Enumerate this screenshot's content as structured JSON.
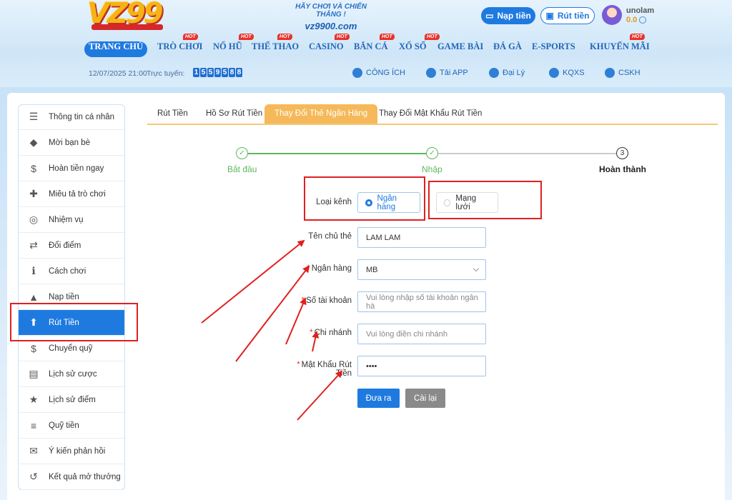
{
  "header": {
    "slogan_line1": "HÃY CHƠI VÀ CHIẾN THẮNG !",
    "slogan_line2": "vz9900.com",
    "deposit_label": "Nạp tiền",
    "withdraw_label": "Rút tiền",
    "username": "unolam",
    "balance": "0.0",
    "hot_badge": "HOT",
    "nav": [
      {
        "label": "TRANG CHỦ",
        "hot": false
      },
      {
        "label": "TRÒ CHƠI",
        "hot": true
      },
      {
        "label": "NỔ HŨ",
        "hot": true
      },
      {
        "label": "THỂ THAO",
        "hot": true
      },
      {
        "label": "CASINO",
        "hot": true
      },
      {
        "label": "BẮN CÁ",
        "hot": true
      },
      {
        "label": "XỔ SỐ",
        "hot": true
      },
      {
        "label": "GAME BÀI",
        "hot": false
      },
      {
        "label": "ĐÁ GÀ",
        "hot": false
      },
      {
        "label": "E-SPORTS",
        "hot": false
      },
      {
        "label": "KHUYẾN MÃI",
        "hot": true
      }
    ],
    "datetime": "12/07/2025 21:00",
    "online_label": "Trực tuyến:",
    "online_digits": [
      "1",
      "5",
      "5",
      "9",
      "5",
      "8",
      "8"
    ],
    "utilities": [
      "CÔNG ÍCH",
      "Tải APP",
      "Đại Lý",
      "KQXS",
      "CSKH"
    ]
  },
  "sidebar": {
    "items": [
      {
        "label": "Thông tin cá nhân",
        "icon": "user-card-icon"
      },
      {
        "label": "Mời bạn bè",
        "icon": "diamond-icon"
      },
      {
        "label": "Hoàn tiền ngay",
        "icon": "cashback-icon"
      },
      {
        "label": "Miêu tả trò chơi",
        "icon": "gamepad-icon"
      },
      {
        "label": "Nhiệm vụ",
        "icon": "target-icon"
      },
      {
        "label": "Đổi điểm",
        "icon": "exchange-icon"
      },
      {
        "label": "Cách chơi",
        "icon": "info-icon"
      },
      {
        "label": "Nạp tiền",
        "icon": "deposit-icon"
      },
      {
        "label": "Rút Tiền",
        "icon": "withdraw-icon"
      },
      {
        "label": "Chuyển quỹ",
        "icon": "transfer-icon"
      },
      {
        "label": "Lịch sử cược",
        "icon": "clipboard-icon"
      },
      {
        "label": "Lịch sử điểm",
        "icon": "star-icon"
      },
      {
        "label": "Quỹ tiền",
        "icon": "coins-icon"
      },
      {
        "label": "Ý kiến phản hồi",
        "icon": "chat-icon"
      },
      {
        "label": "Kết quả mở thưởng",
        "icon": "history-icon"
      }
    ],
    "active_index": 8
  },
  "tabs": [
    "Rút Tiền",
    "Hồ Sơ Rút Tiền",
    "Thay Đổi Thẻ Ngân Hàng",
    "Thay Đổi Mật Khẩu Rút Tiền"
  ],
  "active_tab": 2,
  "steps": [
    {
      "label": "Bắt đầu",
      "state": "done"
    },
    {
      "label": "Nhập",
      "state": "done"
    },
    {
      "label": "Hoàn thành",
      "state": "todo",
      "number": "3"
    }
  ],
  "form": {
    "channel_label": "Loại kênh",
    "channel_options": [
      {
        "label": "Ngân hàng",
        "selected": true
      },
      {
        "label": "Mạng lưới",
        "selected": false
      }
    ],
    "holder_label": "Tên chủ thẻ",
    "holder_value": "LAM LAM",
    "bank_label": "Ngân hàng",
    "bank_value": "MB",
    "account_label": "Số tài khoản",
    "account_placeholder": "Vui lòng nhập số tài khoản ngân hà",
    "branch_label": "Chi nhánh",
    "branch_placeholder": "Vui lòng điền chi nhánh",
    "password_label": "Mật Khẩu Rút Tiền",
    "password_value": "••••",
    "required_mark": "*",
    "submit_label": "Đưa ra",
    "reset_label": "Cài lại"
  },
  "colors": {
    "primary": "#1f7ae0",
    "tab_active": "#f5b95a",
    "step_done": "#5cb85c",
    "annotation": "#e02020"
  }
}
